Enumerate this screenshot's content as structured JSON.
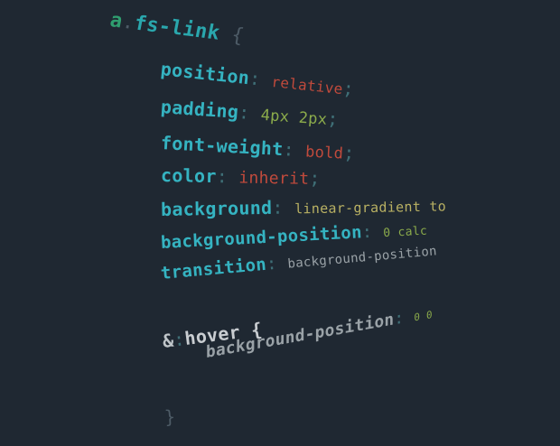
{
  "code": {
    "selector": {
      "tag": "a",
      "dot": ".",
      "class": "fs-link",
      "open": "{"
    },
    "lines": [
      {
        "prop": "position",
        "colon": ":",
        "value": "relative",
        "semi": ";"
      },
      {
        "prop": "padding",
        "colon": ":",
        "value": "4px 2px",
        "semi": ";"
      },
      {
        "prop": "font-weight",
        "colon": ":",
        "value": "bold",
        "semi": ";"
      },
      {
        "prop": "color",
        "colon": ":",
        "value": "inherit",
        "semi": ";"
      },
      {
        "prop": "background",
        "colon": ":",
        "value": "linear-gradient to"
      },
      {
        "prop": "background-position",
        "colon": ":",
        "value": "0 calc"
      },
      {
        "prop": "transition",
        "colon": ":",
        "value": "background-position"
      }
    ],
    "hover": {
      "amp": "&",
      "colon": ":",
      "pseudo": "hover",
      "open": "{"
    },
    "hover_line": {
      "prop": "background-position",
      "colon": ":",
      "value": "0 0"
    },
    "close": "}"
  }
}
